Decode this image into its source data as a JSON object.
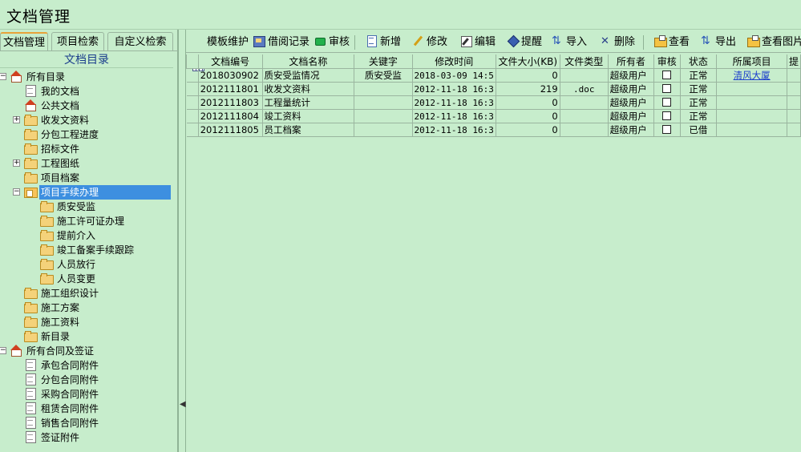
{
  "app": {
    "title": "文档管理"
  },
  "left": {
    "tabs": [
      "文档管理",
      "项目检索",
      "自定义检索"
    ],
    "tree_title": "文档目录",
    "tree": [
      {
        "label": "所有目录"
      },
      {
        "label": "我的文档"
      },
      {
        "label": "公共文档"
      },
      {
        "label": "收发文资料"
      },
      {
        "label": "分包工程进度"
      },
      {
        "label": "招标文件"
      },
      {
        "label": "工程图纸"
      },
      {
        "label": "项目档案"
      },
      {
        "label": "项目手续办理"
      },
      {
        "label": "质安受监"
      },
      {
        "label": "施工许可证办理"
      },
      {
        "label": "提前介入"
      },
      {
        "label": "竣工备案手续跟踪"
      },
      {
        "label": "人员放行"
      },
      {
        "label": "人员变更"
      },
      {
        "label": "施工组织设计"
      },
      {
        "label": "施工方案"
      },
      {
        "label": "施工资料"
      },
      {
        "label": "新目录"
      },
      {
        "label": "所有合同及签证"
      },
      {
        "label": "承包合同附件"
      },
      {
        "label": "分包合同附件"
      },
      {
        "label": "采购合同附件"
      },
      {
        "label": "租赁合同附件"
      },
      {
        "label": "销售合同附件"
      },
      {
        "label": "签证附件"
      }
    ]
  },
  "toolbar": {
    "template": "模板维护",
    "borrow_log": "借阅记录",
    "review": "审核",
    "add": "新增",
    "modify": "修改",
    "edit": "编辑",
    "remind": "提醒",
    "import": "导入",
    "delete": "删除",
    "view": "查看",
    "export": "导出",
    "view_image": "查看图片"
  },
  "table": {
    "headers": [
      "文档编号",
      "文档名称",
      "关键字",
      "修改时间",
      "文件大小(KB)",
      "文件类型",
      "所有者",
      "审核",
      "状态",
      "所属项目",
      "提"
    ],
    "rows": [
      {
        "id": "2018030902",
        "name": "质安受监情况",
        "keyword": "质安受监",
        "mtime": "2018-03-09 14:5",
        "size": "0",
        "type": "",
        "owner": "超级用户",
        "status": "正常",
        "project": "清风大厦"
      },
      {
        "id": "2012111801",
        "name": "收发文资料",
        "keyword": "",
        "mtime": "2012-11-18 16:3",
        "size": "219",
        "type": ".doc",
        "owner": "超级用户",
        "status": "正常",
        "project": ""
      },
      {
        "id": "2012111803",
        "name": "工程量统计",
        "keyword": "",
        "mtime": "2012-11-18 16:3",
        "size": "0",
        "type": "",
        "owner": "超级用户",
        "status": "正常",
        "project": ""
      },
      {
        "id": "2012111804",
        "name": "竣工资料",
        "keyword": "",
        "mtime": "2012-11-18 16:3",
        "size": "0",
        "type": "",
        "owner": "超级用户",
        "status": "正常",
        "project": ""
      },
      {
        "id": "2012111805",
        "name": "员工档案",
        "keyword": "",
        "mtime": "2012-11-18 16:3",
        "size": "0",
        "type": "",
        "owner": "超级用户",
        "status": "已借",
        "project": ""
      }
    ]
  }
}
